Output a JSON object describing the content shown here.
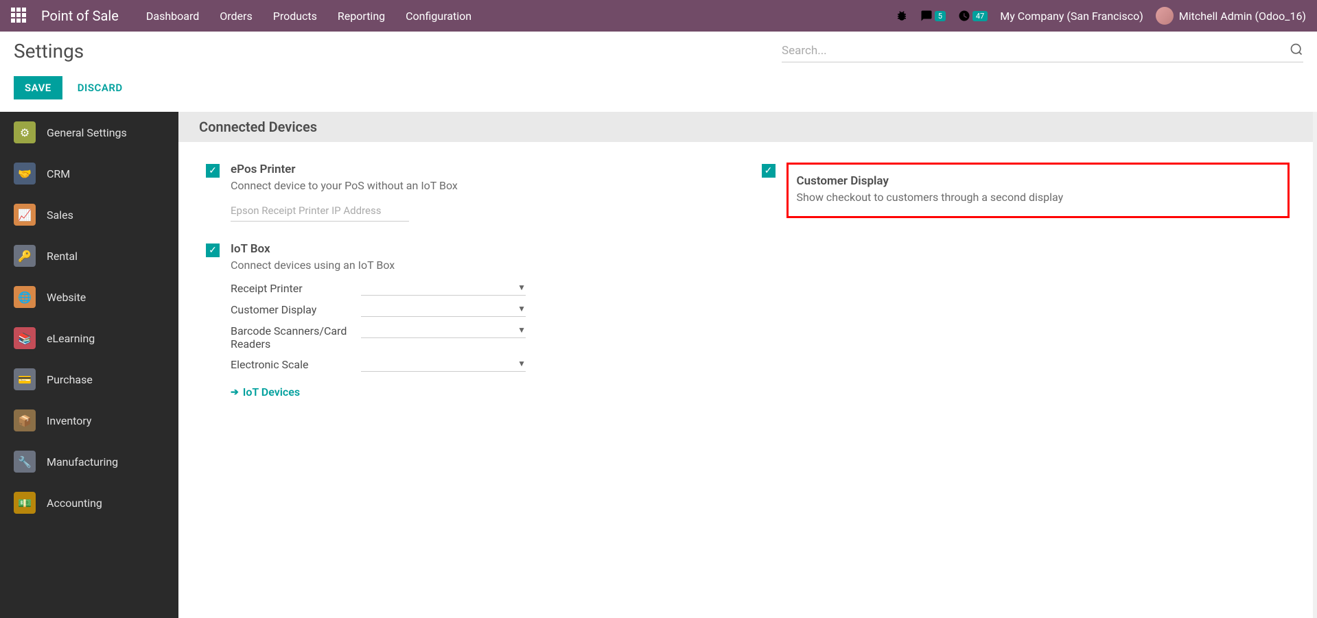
{
  "topnav": {
    "app_title": "Point of Sale",
    "menu": [
      "Dashboard",
      "Orders",
      "Products",
      "Reporting",
      "Configuration"
    ],
    "chat_badge": "5",
    "clock_badge": "47",
    "company": "My Company (San Francisco)",
    "user": "Mitchell Admin (Odoo_16)"
  },
  "header": {
    "title": "Settings",
    "search_placeholder": "Search...",
    "save": "SAVE",
    "discard": "DISCARD"
  },
  "sidebar": {
    "items": [
      {
        "label": "General Settings",
        "color": "#9BA644"
      },
      {
        "label": "CRM",
        "color": "#4B5E7A"
      },
      {
        "label": "Sales",
        "color": "#D88847"
      },
      {
        "label": "Rental",
        "color": "#6B7280"
      },
      {
        "label": "Website",
        "color": "#D88847"
      },
      {
        "label": "eLearning",
        "color": "#C44D58"
      },
      {
        "label": "Purchase",
        "color": "#6B7280"
      },
      {
        "label": "Inventory",
        "color": "#8B6F47"
      },
      {
        "label": "Manufacturing",
        "color": "#6B7280"
      },
      {
        "label": "Accounting",
        "color": "#B8860B"
      }
    ]
  },
  "section": {
    "title": "Connected Devices"
  },
  "epos": {
    "title": "ePos Printer",
    "desc": "Connect device to your PoS without an IoT Box",
    "placeholder": "Epson Receipt Printer IP Address"
  },
  "customer_display": {
    "title": "Customer Display",
    "desc": "Show checkout to customers through a second display"
  },
  "iotbox": {
    "title": "IoT Box",
    "desc": "Connect devices using an IoT Box",
    "fields": {
      "receipt": "Receipt Printer",
      "customer_display": "Customer Display",
      "barcode": "Barcode Scanners/Card Readers",
      "scale": "Electronic Scale"
    },
    "link": "IoT Devices"
  }
}
